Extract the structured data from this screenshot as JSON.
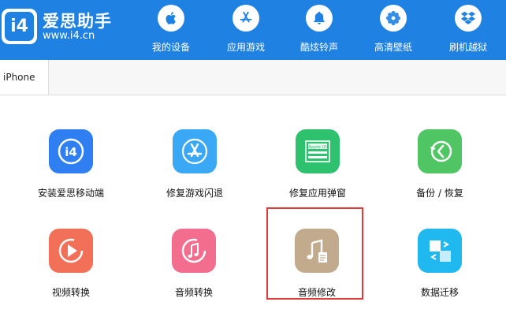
{
  "app": {
    "brand_name": "爱思助手",
    "url": "www.i4.cn",
    "logo_mark": "i4"
  },
  "nav": [
    {
      "label": "我的设备",
      "icon": "apple-icon"
    },
    {
      "label": "应用游戏",
      "icon": "app-store-icon"
    },
    {
      "label": "酷炫铃声",
      "icon": "bell-icon"
    },
    {
      "label": "高清壁纸",
      "icon": "flower-icon"
    },
    {
      "label": "刷机越狱",
      "icon": "dropbox-icon"
    }
  ],
  "tabs": [
    {
      "label": "iPhone",
      "active": true
    }
  ],
  "tools": [
    {
      "label": "安装爱思移动端",
      "icon": "i4-app-icon",
      "color": "#2f7ff2"
    },
    {
      "label": "修复游戏闪退",
      "icon": "app-store-icon",
      "color": "#3aa8f5"
    },
    {
      "label": "修复应用弹窗",
      "icon": "apple-id-icon",
      "color": "#2ec26f"
    },
    {
      "label": "备份 / 恢复",
      "icon": "backup-restore-icon",
      "color": "#4fc663"
    },
    {
      "label": "视频转换",
      "icon": "video-convert-icon",
      "color": "#f37058"
    },
    {
      "label": "音频转换",
      "icon": "audio-convert-icon",
      "color": "#f26d8e"
    },
    {
      "label": "音频修改",
      "icon": "audio-edit-icon",
      "color": "#c1ab8c",
      "highlighted": true
    },
    {
      "label": "数据迁移",
      "icon": "data-migrate-icon",
      "color": "#1fb8ef"
    }
  ],
  "colors": {
    "header": "#1f82e3",
    "highlight_border": "#e03a3a"
  }
}
